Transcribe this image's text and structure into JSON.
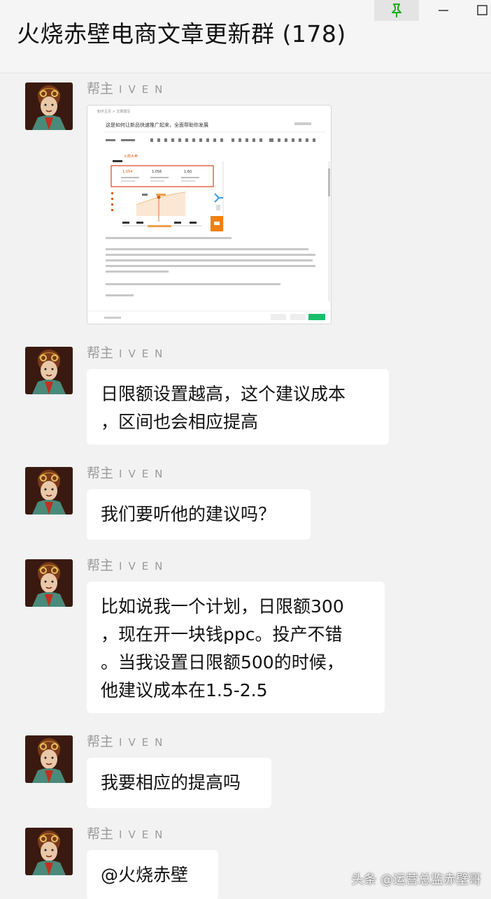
{
  "window": {
    "title": "火烧赤壁电商文章更新群 (178)",
    "controls": [
      "pin-icon",
      "minimize-icon",
      "maximize-icon"
    ]
  },
  "colors": {
    "background": "#f2f2f2",
    "bubble": "#ffffff",
    "pin_green": "#1aad19",
    "sender_gray": "#9a9a9a"
  },
  "messages": [
    {
      "sender_cn": "帮主",
      "sender_latin": "IVEN",
      "type": "image",
      "image_text": {
        "breadcrumb": "知乎主页 > 文章撰写",
        "heading": "这是如何让新品快速推广起来，全面帮助你发展",
        "ad_header": "火箭大卖",
        "metric1": "1,054",
        "metric2": "1,056",
        "metric3": "1,60"
      }
    },
    {
      "sender_cn": "帮主",
      "sender_latin": "IVEN",
      "type": "text",
      "lines": [
        "日限额设置越高，这个建议成本",
        "，区间也会相应提高"
      ]
    },
    {
      "sender_cn": "帮主",
      "sender_latin": "IVEN",
      "type": "text",
      "lines": [
        "我们要听他的建议吗？"
      ]
    },
    {
      "sender_cn": "帮主",
      "sender_latin": "IVEN",
      "type": "text",
      "lines": [
        "比如说我一个计划，日限额300",
        "，现在开一块钱ppc。投产不错",
        "。当我设置日限额500的时候，",
        "他建议成本在1.5-2.5"
      ]
    },
    {
      "sender_cn": "帮主",
      "sender_latin": "IVEN",
      "type": "text",
      "lines": [
        "我要相应的提高吗"
      ]
    },
    {
      "sender_cn": "帮主",
      "sender_latin": "IVEN",
      "type": "text",
      "lines": [
        "@火烧赤壁"
      ]
    }
  ],
  "watermark": "头条 @运营总监赤壁哥"
}
